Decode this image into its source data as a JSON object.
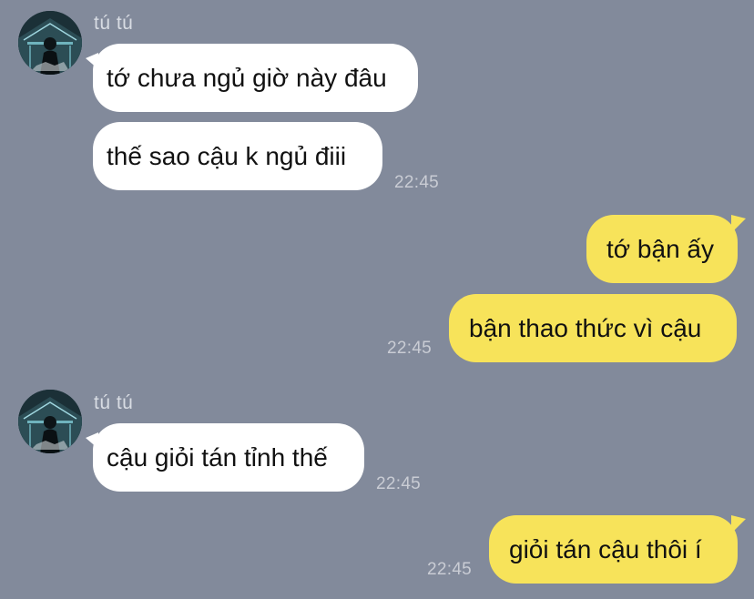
{
  "chat": {
    "groups": [
      {
        "sender": "tú tú",
        "messages": [
          {
            "text": "tớ chưa ngủ giờ này đâu"
          },
          {
            "text": "thế sao cậu k ngủ điii",
            "time": "22:45"
          }
        ]
      },
      {
        "sender": null,
        "messages": [
          {
            "text": "tớ bận ấy"
          },
          {
            "text": "bận thao thức vì cậu",
            "time": "22:45"
          }
        ]
      },
      {
        "sender": "tú tú",
        "messages": [
          {
            "text": "cậu giỏi tán tỉnh thế",
            "time": "22:45"
          }
        ]
      },
      {
        "sender": null,
        "messages": [
          {
            "text": "giỏi tán cậu thôi í",
            "time": "22:45"
          }
        ]
      }
    ]
  },
  "colors": {
    "background": "#828a9b",
    "incoming_bubble": "#ffffff",
    "outgoing_bubble": "#f7e35a",
    "timestamp": "#c9ccd4"
  }
}
